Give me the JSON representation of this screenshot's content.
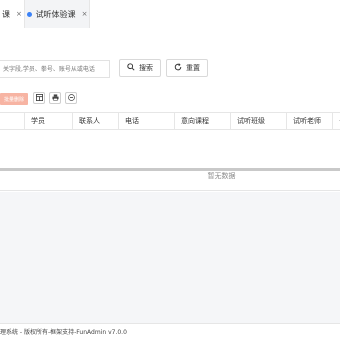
{
  "tabs": [
    {
      "label": "课",
      "close": "×"
    },
    {
      "label": "试听体验课",
      "close": "×",
      "active": true
    }
  ],
  "search": {
    "placeholder": "关字段,学员、拳号、账号从或电话",
    "search_label": "搜索",
    "reset_label": "重置"
  },
  "toolbar": {
    "delete_label": "批量删除",
    "icons": [
      "grid-icon",
      "print-icon",
      "export-icon"
    ]
  },
  "table": {
    "columns": [
      "",
      "学员",
      "联系人",
      "电话",
      "意向课程",
      "试听班级",
      "试听老师",
      "·"
    ],
    "empty_text": "暂无数据"
  },
  "footer": {
    "text": "理系统 - 版权所有-框架支持-FunAdmin v7.0.0"
  },
  "colors": {
    "accent": "#3b82f6",
    "danger_light": "#f7b4a3"
  }
}
